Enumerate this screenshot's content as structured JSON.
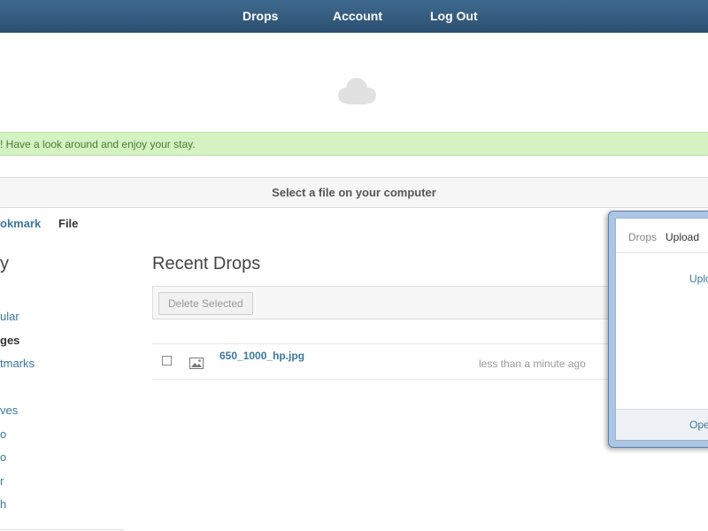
{
  "nav": {
    "items": [
      "Drops",
      "Account",
      "Log Out"
    ]
  },
  "notice": {
    "text": "! Have a look around and enjoy your stay."
  },
  "upload": {
    "select_label": "Select a file on your computer"
  },
  "tabs": {
    "bookmark": "okmark",
    "file": "File"
  },
  "sidebar": {
    "title": "y",
    "items": [
      "ular",
      "ges",
      "tmarks",
      "ves",
      "o",
      "o",
      "r",
      "h"
    ]
  },
  "main": {
    "title": "Recent Drops",
    "delete_label": "Delete Selected",
    "rows": [
      {
        "name": "650_1000_hp.jpg",
        "time": "less than a minute ago"
      }
    ]
  },
  "window": {
    "tabs": [
      "Drops",
      "Upload"
    ],
    "link": "Uplo",
    "footer_link": "Ope"
  },
  "colors": {
    "topbar": "#2f5779",
    "notice_bg": "#d4f2c2",
    "link": "#3b78a0"
  }
}
